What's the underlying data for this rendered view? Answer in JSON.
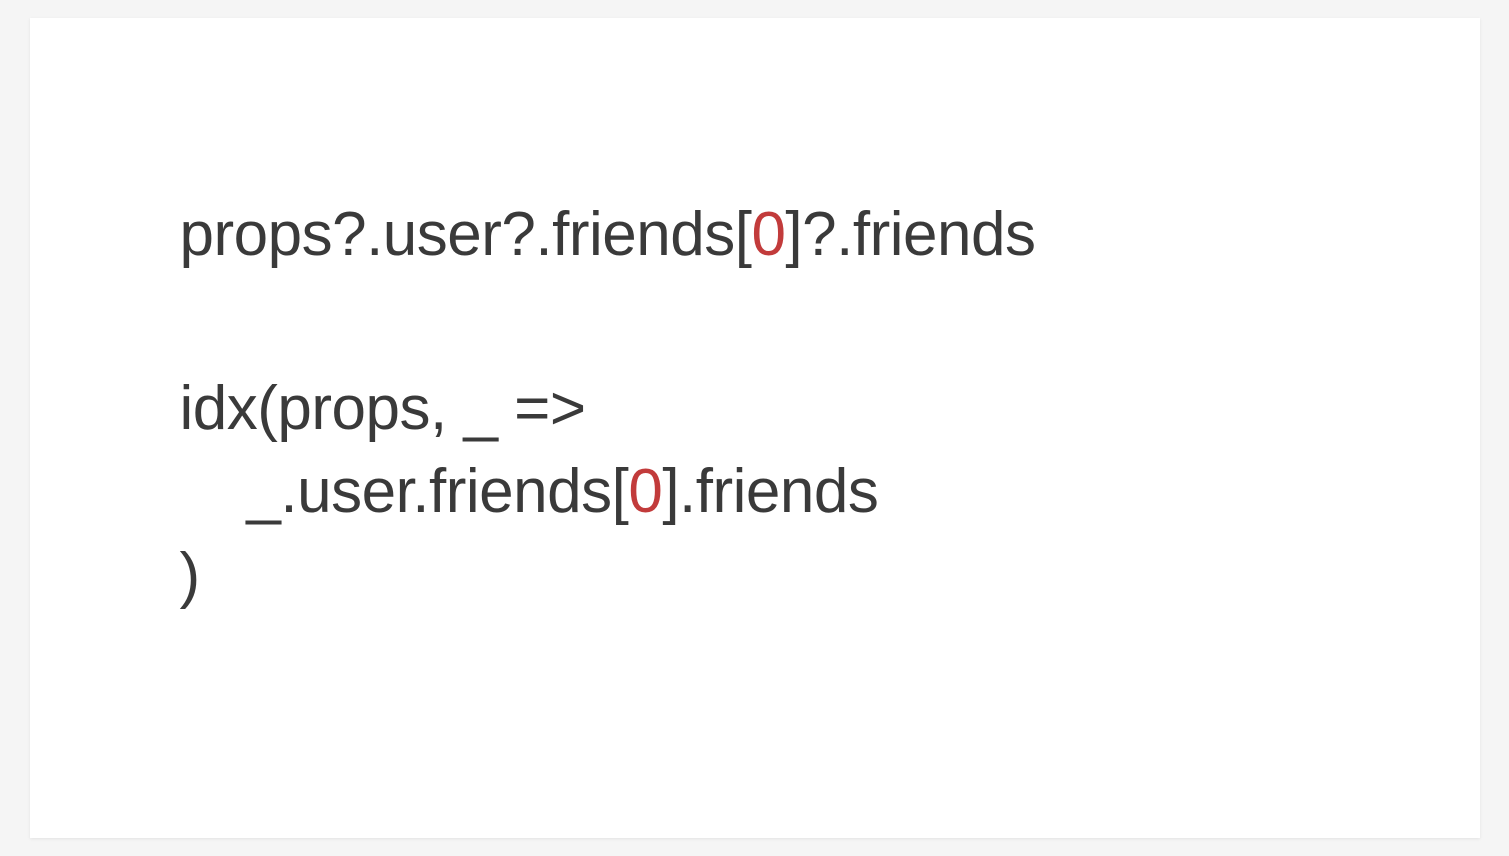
{
  "slide": {
    "code1": {
      "line1_a": "props?.user?.friends[",
      "line1_num": "0",
      "line1_b": "]?.friends"
    },
    "code2": {
      "line1": "idx(props, _ =>",
      "line2_a": "    _.user.friends[",
      "line2_num": "0",
      "line2_b": "].friends",
      "line3": ")"
    }
  }
}
